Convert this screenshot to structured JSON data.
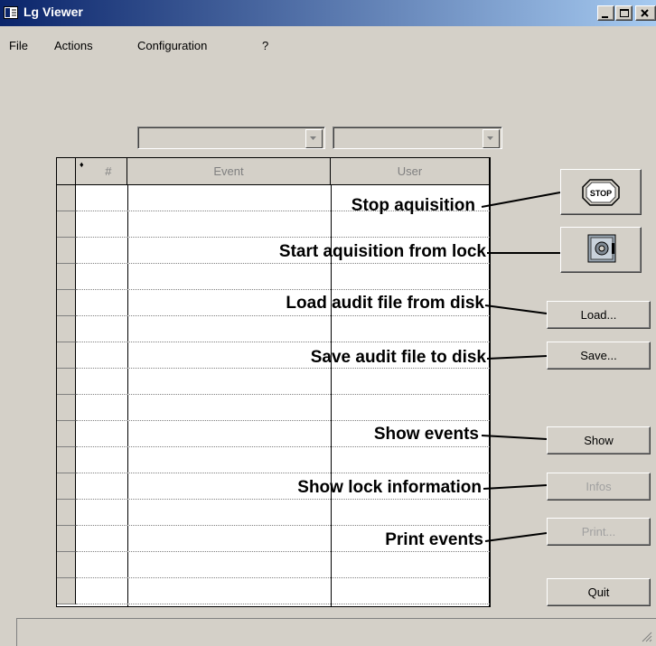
{
  "window": {
    "title": "Lg Viewer"
  },
  "menu": {
    "file": "File",
    "actions": "Actions",
    "configuration": "Configuration",
    "help": "?"
  },
  "grid": {
    "col_sort_marker": "♦",
    "col_number": "#",
    "col_event": "Event",
    "col_user": "User"
  },
  "callouts": {
    "stop": "Stop aquisition",
    "start": "Start aquisition from lock",
    "load": "Load audit file from disk",
    "save": "Save audit file to disk",
    "show": "Show events",
    "infos": "Show lock information",
    "print": "Print events"
  },
  "buttons": {
    "stop_icon_text": "STOP",
    "load": "Load...",
    "save": "Save...",
    "show": "Show",
    "infos": "Infos",
    "print": "Print...",
    "quit": "Quit"
  },
  "icons": {
    "app": "app-icon",
    "stop": "stop-sign-icon",
    "safe": "safe-icon",
    "minimize": "minimize-icon",
    "maximize": "maximize-icon",
    "close": "close-icon",
    "dropdown": "chevron-down-icon"
  }
}
